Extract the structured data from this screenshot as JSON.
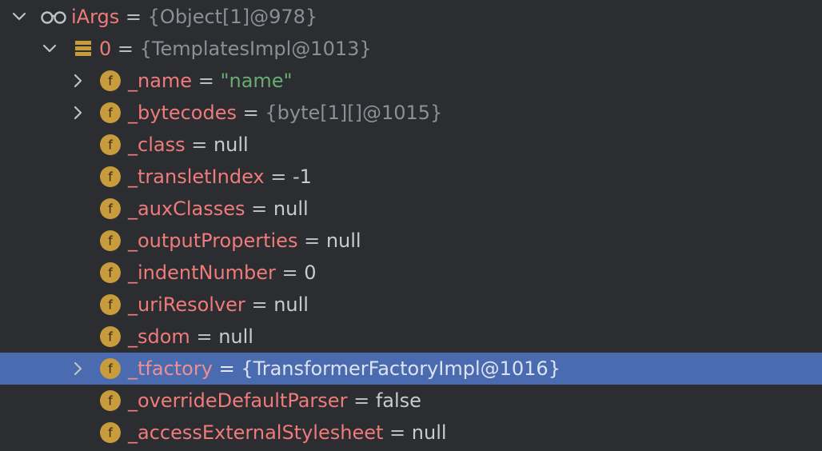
{
  "rows": [
    {
      "name": "iArgs",
      "eq": " = ",
      "value": "{Object[1]@978}",
      "value_style": "ref",
      "icon": "watch-glasses-icon",
      "expander": "chevron-down-icon",
      "level": 0,
      "selected": false
    },
    {
      "name": "0",
      "eq": " = ",
      "value": "{TemplatesImpl@1013}",
      "value_style": "ref",
      "icon": "array-element-icon",
      "expander": "chevron-down-icon",
      "level": 1,
      "selected": false
    },
    {
      "name": "_name",
      "eq": " = ",
      "value": "\"name\"",
      "value_style": "str",
      "icon": "field-icon",
      "expander": "chevron-right-icon",
      "level": 2,
      "selected": false
    },
    {
      "name": "_bytecodes",
      "eq": " = ",
      "value": "{byte[1][]@1015}",
      "value_style": "ref",
      "icon": "field-icon",
      "expander": "chevron-right-icon",
      "level": 2,
      "selected": false
    },
    {
      "name": "_class",
      "eq": " = ",
      "value": "null",
      "value_style": "val",
      "icon": "field-icon",
      "expander": "",
      "level": 2,
      "selected": false
    },
    {
      "name": "_transletIndex",
      "eq": " = ",
      "value": "-1",
      "value_style": "val",
      "icon": "field-icon",
      "expander": "",
      "level": 2,
      "selected": false
    },
    {
      "name": "_auxClasses",
      "eq": " = ",
      "value": "null",
      "value_style": "val",
      "icon": "field-icon",
      "expander": "",
      "level": 2,
      "selected": false
    },
    {
      "name": "_outputProperties",
      "eq": " = ",
      "value": "null",
      "value_style": "val",
      "icon": "field-icon",
      "expander": "",
      "level": 2,
      "selected": false
    },
    {
      "name": "_indentNumber",
      "eq": " = ",
      "value": "0",
      "value_style": "val",
      "icon": "field-icon",
      "expander": "",
      "level": 2,
      "selected": false
    },
    {
      "name": "_uriResolver",
      "eq": " = ",
      "value": "null",
      "value_style": "val",
      "icon": "field-icon",
      "expander": "",
      "level": 2,
      "selected": false
    },
    {
      "name": "_sdom",
      "eq": " = ",
      "value": "null",
      "value_style": "val",
      "icon": "field-icon",
      "expander": "",
      "level": 2,
      "selected": false
    },
    {
      "name": "_tfactory",
      "eq": " = ",
      "value": "{TransformerFactoryImpl@1016}",
      "value_style": "ref",
      "icon": "field-icon",
      "expander": "chevron-right-icon",
      "level": 2,
      "selected": true
    },
    {
      "name": "_overrideDefaultParser",
      "eq": " = ",
      "value": "false",
      "value_style": "val",
      "icon": "field-icon",
      "expander": "",
      "level": 2,
      "selected": false
    },
    {
      "name": "_accessExternalStylesheet",
      "eq": " = ",
      "value": "null",
      "value_style": "val",
      "icon": "field-icon",
      "expander": "",
      "level": 2,
      "selected": false
    }
  ],
  "field_icon_letter": "f",
  "colors": {
    "background": "#2b2d30",
    "selection": "#4a6bb0",
    "name": "#ef7b7b",
    "string": "#6aab73",
    "reference": "#8c8f95",
    "field_icon": "#c89b3c"
  }
}
